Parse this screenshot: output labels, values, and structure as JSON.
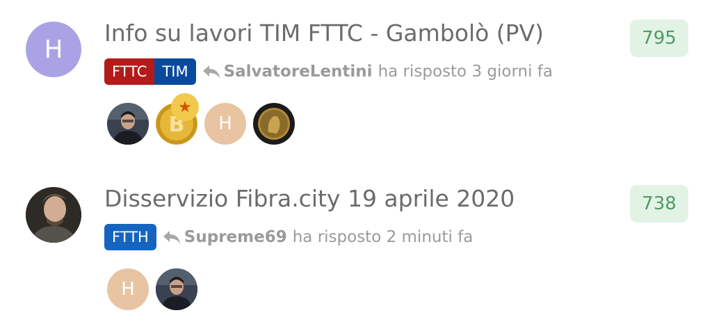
{
  "colors": {
    "title_text": "#6b6b6b",
    "meta_text": "#9a9a9a",
    "count_bg": "#e2f3e6",
    "count_text": "#4f9a64",
    "tag_fttc": "#b31b1b",
    "tag_tim": "#0a4a9c",
    "tag_ftth": "#1565c0",
    "avatar_h_purple": "#a9a3e6",
    "avatar_h_beige": "#e8c4a2"
  },
  "topics": [
    {
      "avatar_letter": "H",
      "title": "Info su lavori TIM FTTC - Gambolò (PV)",
      "tags": [
        "FTTC",
        "TIM"
      ],
      "reply_icon": "reply-icon",
      "last_reply_user": "SalvatoreLentini",
      "last_reply_text": "ha risposto 3 giorni fa",
      "posters": [
        {
          "type": "photo",
          "icon": "person-photo"
        },
        {
          "type": "photo",
          "icon": "bitcoin-coin-avatar",
          "badge": "star-icon"
        },
        {
          "type": "letter",
          "letter": "H"
        },
        {
          "type": "photo",
          "icon": "euro-coin-avatar"
        }
      ],
      "count": "795"
    },
    {
      "avatar_letter": "",
      "avatar_icon": "person-photo",
      "title": "Disservizio Fibra.city 19 aprile 2020",
      "tags": [
        "FTTH"
      ],
      "reply_icon": "reply-icon",
      "last_reply_user": "Supreme69",
      "last_reply_text": "ha risposto 2 minuti fa",
      "posters": [
        {
          "type": "letter",
          "letter": "H"
        },
        {
          "type": "photo",
          "icon": "person-photo"
        }
      ],
      "count": "738"
    }
  ]
}
